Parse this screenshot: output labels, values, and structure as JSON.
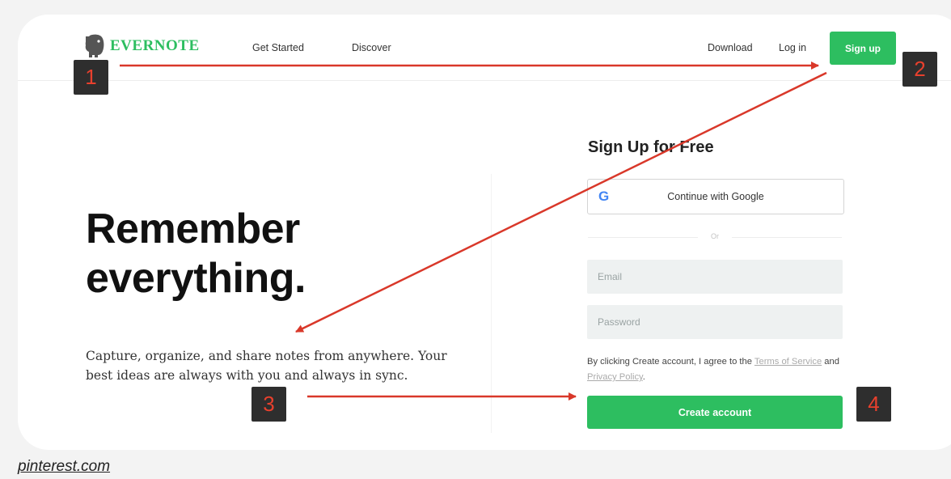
{
  "header": {
    "logo_text": "EVERNOTE",
    "nav_left": [
      "Get Started",
      "Discover"
    ],
    "download_label": "Download",
    "login_label": "Log in",
    "signup_label": "Sign up"
  },
  "hero": {
    "title_line1": "Remember",
    "title_line2": "everything.",
    "subtitle": "Capture, organize, and share notes from anywhere. Your best ideas are always with you and always in sync."
  },
  "form": {
    "title": "Sign Up for Free",
    "google_label": "Continue with Google",
    "google_icon": "G",
    "or_label": "Or",
    "email_placeholder": "Email",
    "password_placeholder": "Password",
    "terms_prefix": "By clicking Create account, I agree to the ",
    "terms_link": "Terms of Service",
    "terms_and": " and ",
    "privacy_link": "Privacy Policy",
    "terms_suffix": ".",
    "create_label": "Create account"
  },
  "annotations": {
    "badges": [
      "1",
      "2",
      "3",
      "4"
    ],
    "arrow_color": "#d9382a"
  },
  "colors": {
    "brand_green": "#2dbe60",
    "badge_bg": "#2e2e2e",
    "badge_text": "#e8402d"
  },
  "source": {
    "label": "pinterest.com"
  }
}
